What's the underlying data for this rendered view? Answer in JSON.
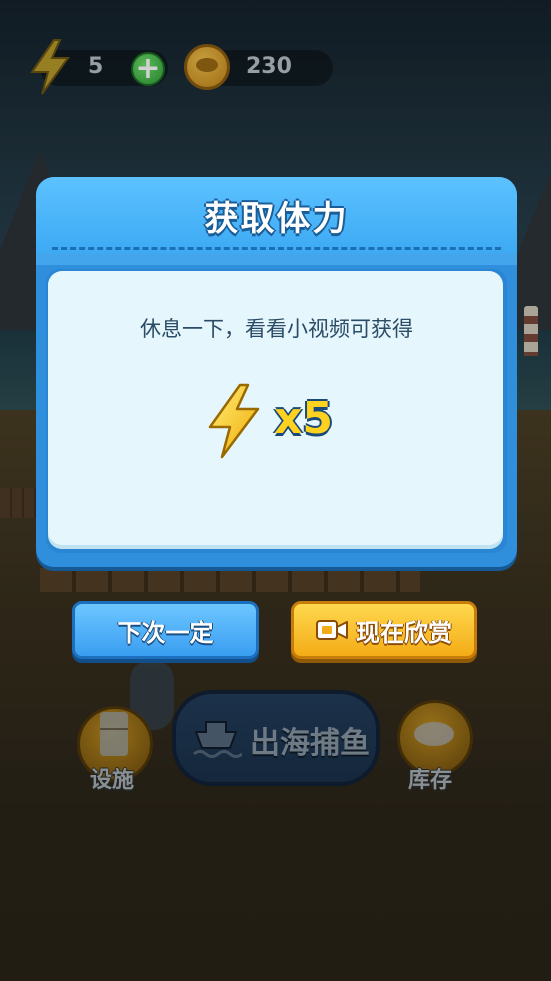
{
  "hud": {
    "energy_value": "5",
    "add_button_symbol": "+",
    "coin_value": "230",
    "icons": [
      "lightning-bolt-icon",
      "plus-icon",
      "coin-icon"
    ]
  },
  "modal": {
    "title": "获取体力",
    "description": "休息一下，看看小视频可获得",
    "reward_amount": "x5",
    "reward_icon": "lightning-bolt-icon",
    "buttons": {
      "next_time": "下次一定",
      "watch_now": "现在欣赏",
      "watch_icon": "video-camera-icon"
    }
  },
  "bottom_nav": {
    "facility_label": "设施",
    "go_fishing_label": "出海捕鱼",
    "inventory_label": "库存"
  },
  "colors": {
    "modal_header": "#4db6fb",
    "modal_panel": "#e5f6fc",
    "next_button": "#3a9ef1",
    "watch_button": "#f4ac16",
    "reward_text": "#ffd220"
  }
}
